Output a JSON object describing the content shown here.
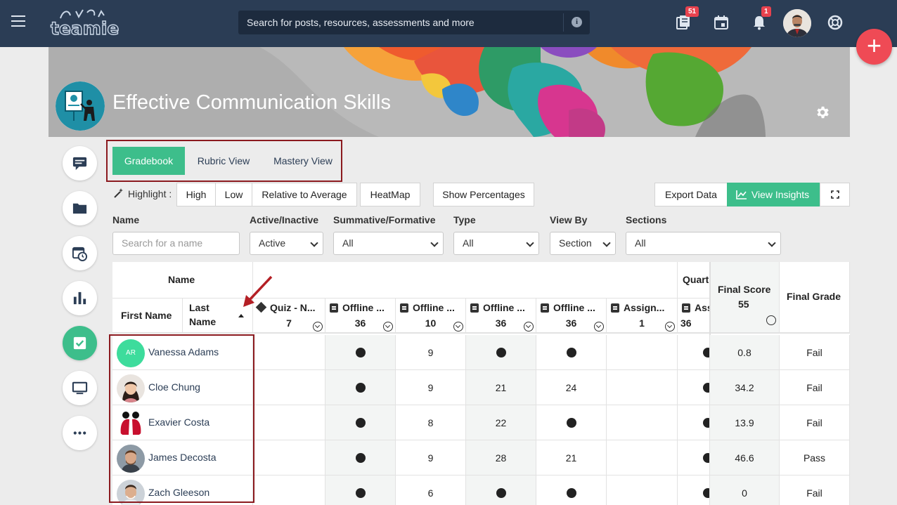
{
  "topbar": {
    "logo_text": "teamie",
    "search_placeholder": "Search for posts, resources, assessments and more",
    "resources_badge": "51",
    "notifications_badge": "1"
  },
  "course": {
    "title": "Effective Communication Skills"
  },
  "tabs": [
    {
      "label": "Gradebook",
      "active": true
    },
    {
      "label": "Rubric View",
      "active": false
    },
    {
      "label": "Mastery View",
      "active": false
    }
  ],
  "toolbar": {
    "highlight_label": "Highlight :",
    "highlight_options": [
      "High",
      "Low",
      "Relative to Average"
    ],
    "heatmap": "HeatMap",
    "show_percentages": "Show Percentages",
    "export_data": "Export Data",
    "view_insights": "View Insights"
  },
  "filters": {
    "name_label": "Name",
    "name_placeholder": "Search for a name",
    "active_label": "Active/Inactive",
    "active_value": "Active",
    "summative_label": "Summative/Formative",
    "summative_value": "All",
    "type_label": "Type",
    "type_value": "All",
    "viewby_label": "View By",
    "viewby_value": "Section",
    "sections_label": "Sections",
    "sections_value": "All"
  },
  "grid": {
    "name_group": "Name",
    "quarter_group": "Quart",
    "first_name_header": "First Name",
    "last_name_header_1": "Last",
    "last_name_header_2": "Name",
    "final_score_header": "Final Score",
    "final_score_total": "55",
    "final_grade_header": "Final Grade",
    "columns": [
      {
        "title": "Quiz - N...",
        "max": "7"
      },
      {
        "title": "Offline ...",
        "max": "36"
      },
      {
        "title": "Offline ...",
        "max": "10"
      },
      {
        "title": "Offline ...",
        "max": "36"
      },
      {
        "title": "Offline ...",
        "max": "36"
      },
      {
        "title": "Assign...",
        "max": "1"
      },
      {
        "title": "Ass",
        "max": "36"
      }
    ],
    "rows": [
      {
        "name": "Vanessa Adams",
        "initials": "AR",
        "cells": [
          "",
          "●",
          "9",
          "●",
          "●",
          "",
          "●"
        ],
        "score": "0.8",
        "grade": "Fail"
      },
      {
        "name": "Cloe Chung",
        "initials": "",
        "cells": [
          "",
          "●",
          "9",
          "21",
          "24",
          "",
          "●"
        ],
        "score": "34.2",
        "grade": "Fail"
      },
      {
        "name": "Exavier Costa",
        "initials": "",
        "cells": [
          "",
          "●",
          "8",
          "22",
          "●",
          "",
          "●"
        ],
        "score": "13.9",
        "grade": "Fail"
      },
      {
        "name": "James Decosta",
        "initials": "",
        "cells": [
          "",
          "●",
          "9",
          "28",
          "21",
          "",
          "●"
        ],
        "score": "46.6",
        "grade": "Pass"
      },
      {
        "name": "Zach Gleeson",
        "initials": "",
        "cells": [
          "",
          "●",
          "6",
          "●",
          "●",
          "",
          "●"
        ],
        "score": "0",
        "grade": "Fail"
      }
    ]
  },
  "colors": {
    "topbar": "#2b3d55",
    "accent_green": "#3dbe8b",
    "fab_red": "#ef4a55",
    "annotation": "#8b1a1f"
  }
}
